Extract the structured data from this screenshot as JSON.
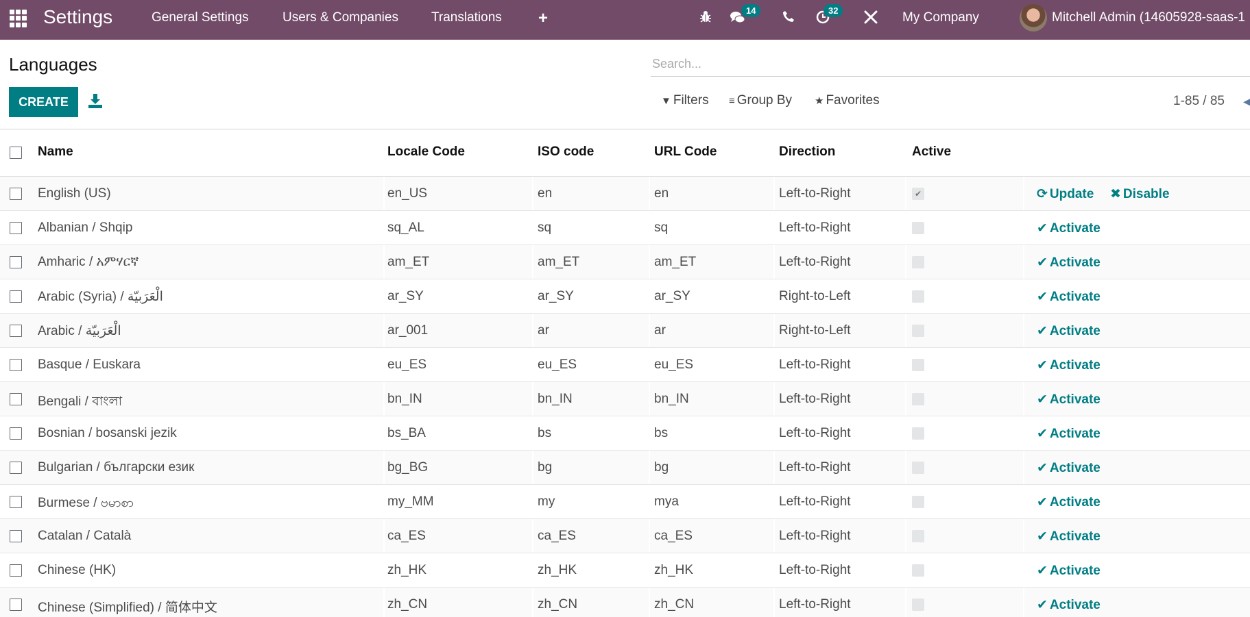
{
  "navbar": {
    "app_title": "Settings",
    "menus": [
      "General Settings",
      "Users & Companies",
      "Translations"
    ],
    "add_menu_icon": "+",
    "icons": {
      "debug": "bug-icon",
      "messages": "chat-icon",
      "phone": "phone-icon",
      "activities": "clock-icon",
      "tools": "tools-icon"
    },
    "messages_badge": "14",
    "activities_badge": "32",
    "company": "My Company",
    "user": "Mitchell Admin (14605928-saas-1"
  },
  "page": {
    "title": "Languages",
    "create_label": "CREATE",
    "search_placeholder": "Search...",
    "filters_label": "Filters",
    "groupby_label": "Group By",
    "favorites_label": "Favorites",
    "pager": "1-85 / 85"
  },
  "table": {
    "columns": [
      "Name",
      "Locale Code",
      "ISO code",
      "URL Code",
      "Direction",
      "Active"
    ],
    "rows": [
      {
        "name": "English (US)",
        "locale": "en_US",
        "iso": "en",
        "url": "en",
        "direction": "Left-to-Right",
        "active": true,
        "actions": [
          "Update",
          "Disable"
        ]
      },
      {
        "name": "Albanian / Shqip",
        "locale": "sq_AL",
        "iso": "sq",
        "url": "sq",
        "direction": "Left-to-Right",
        "active": false,
        "actions": [
          "Activate"
        ]
      },
      {
        "name": "Amharic / አምሃርኛ",
        "locale": "am_ET",
        "iso": "am_ET",
        "url": "am_ET",
        "direction": "Left-to-Right",
        "active": false,
        "actions": [
          "Activate"
        ]
      },
      {
        "name": "Arabic (Syria) / الْعَرَبيّة",
        "locale": "ar_SY",
        "iso": "ar_SY",
        "url": "ar_SY",
        "direction": "Right-to-Left",
        "active": false,
        "actions": [
          "Activate"
        ]
      },
      {
        "name": "Arabic / الْعَرَبيّة",
        "locale": "ar_001",
        "iso": "ar",
        "url": "ar",
        "direction": "Right-to-Left",
        "active": false,
        "actions": [
          "Activate"
        ]
      },
      {
        "name": "Basque / Euskara",
        "locale": "eu_ES",
        "iso": "eu_ES",
        "url": "eu_ES",
        "direction": "Left-to-Right",
        "active": false,
        "actions": [
          "Activate"
        ]
      },
      {
        "name": "Bengali / বাংলা",
        "locale": "bn_IN",
        "iso": "bn_IN",
        "url": "bn_IN",
        "direction": "Left-to-Right",
        "active": false,
        "actions": [
          "Activate"
        ]
      },
      {
        "name": "Bosnian / bosanski jezik",
        "locale": "bs_BA",
        "iso": "bs",
        "url": "bs",
        "direction": "Left-to-Right",
        "active": false,
        "actions": [
          "Activate"
        ]
      },
      {
        "name": "Bulgarian / български език",
        "locale": "bg_BG",
        "iso": "bg",
        "url": "bg",
        "direction": "Left-to-Right",
        "active": false,
        "actions": [
          "Activate"
        ]
      },
      {
        "name": "Burmese / ဗမာစာ",
        "locale": "my_MM",
        "iso": "my",
        "url": "mya",
        "direction": "Left-to-Right",
        "active": false,
        "actions": [
          "Activate"
        ]
      },
      {
        "name": "Catalan / Català",
        "locale": "ca_ES",
        "iso": "ca_ES",
        "url": "ca_ES",
        "direction": "Left-to-Right",
        "active": false,
        "actions": [
          "Activate"
        ]
      },
      {
        "name": "Chinese (HK)",
        "locale": "zh_HK",
        "iso": "zh_HK",
        "url": "zh_HK",
        "direction": "Left-to-Right",
        "active": false,
        "actions": [
          "Activate"
        ]
      },
      {
        "name": "Chinese (Simplified) / 简体中文",
        "locale": "zh_CN",
        "iso": "zh_CN",
        "url": "zh_CN",
        "direction": "Left-to-Right",
        "active": false,
        "actions": [
          "Activate"
        ]
      }
    ]
  },
  "colors": {
    "navbar": "#714b67",
    "primary": "#017e84"
  }
}
